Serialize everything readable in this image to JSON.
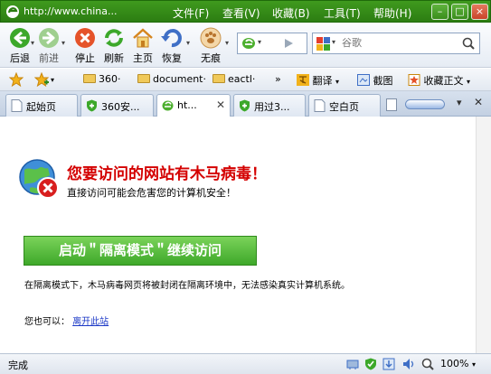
{
  "window": {
    "title": "http://www.china...",
    "menu": [
      "文件(F)",
      "查看(V)",
      "收藏(B)",
      "工具(T)",
      "帮助(H)"
    ],
    "controls": {
      "minimize": "–",
      "restore": "□",
      "close": "×"
    }
  },
  "toolbar": {
    "back": "后退",
    "forward": "前进",
    "stop": "停止",
    "refresh": "刷新",
    "home": "主页",
    "restore": "恢复",
    "private": "无痕"
  },
  "search": {
    "placeholder": "谷歌"
  },
  "favorites": {
    "items": [
      "360·",
      "document·",
      "eactl·"
    ],
    "translate": "翻译",
    "screenshot": "截图",
    "collect": "收藏正文",
    "more": "»"
  },
  "tabs": [
    {
      "label": "起始页",
      "active": false,
      "icon": "page-icon"
    },
    {
      "label": "360安...",
      "active": false,
      "icon": "shield-icon"
    },
    {
      "label": "ht...",
      "active": true,
      "icon": "ie-icon"
    },
    {
      "label": "用过3...",
      "active": false,
      "icon": "shield-icon"
    },
    {
      "label": "空白页",
      "active": false,
      "icon": "page-icon"
    }
  ],
  "warning": {
    "title": "您要访问的网站有木马病毒！",
    "subtitle": "直接访问可能会危害您的计算机安全！",
    "button": "启动＂隔离模式＂继续访问",
    "description": "在隔离模式下，木马病毒网页将被封闭在隔离环境中，无法感染真实计算机系统。",
    "leave_prefix": "您也可以：",
    "leave_link": "离开此站"
  },
  "status": {
    "text": "完成",
    "zoom": "100%"
  },
  "colors": {
    "title_bar": "#3f9a1e",
    "warning_red": "#d40000",
    "button_green": "#4fb536",
    "link_blue": "#1a37c6"
  }
}
